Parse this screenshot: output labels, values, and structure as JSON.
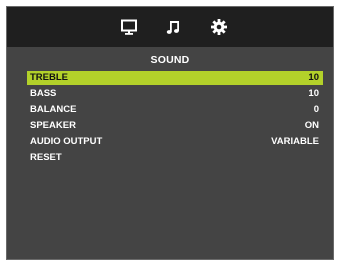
{
  "tabs": [
    {
      "icon": "monitor-icon"
    },
    {
      "icon": "music-note-icon"
    },
    {
      "icon": "gear-icon"
    }
  ],
  "section_title": "SOUND",
  "menu": {
    "items": [
      {
        "label": "TREBLE",
        "value": "10",
        "selected": true
      },
      {
        "label": "BASS",
        "value": "10"
      },
      {
        "label": "BALANCE",
        "value": "0"
      },
      {
        "label": "SPEAKER",
        "value": "ON"
      },
      {
        "label": "AUDIO OUTPUT",
        "value": "VARIABLE"
      },
      {
        "label": "RESET",
        "value": ""
      }
    ]
  },
  "colors": {
    "panel": "#444444",
    "topbar": "#1f1f1f",
    "highlight": "#b3d12a",
    "text": "#ffffff"
  }
}
